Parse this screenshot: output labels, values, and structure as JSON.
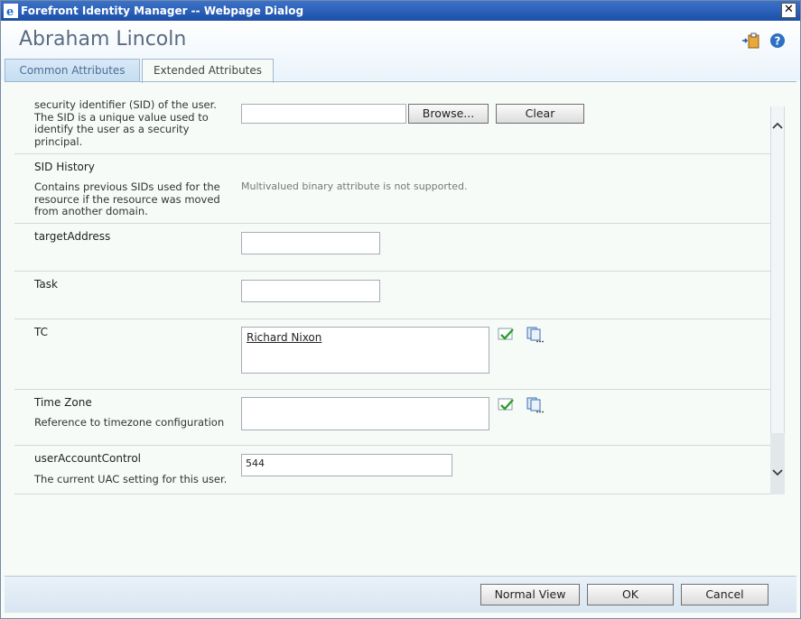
{
  "window": {
    "title": "Forefront Identity Manager -- Webpage Dialog",
    "close_label": "✕"
  },
  "header": {
    "title": "Abraham Lincoln",
    "icons": [
      "clipboard-icon",
      "help-icon"
    ]
  },
  "tabs": [
    {
      "label": "Common Attributes",
      "active": false
    },
    {
      "label": "Extended Attributes",
      "active": true
    }
  ],
  "rows": {
    "sid": {
      "desc_lines": [
        "security identifier (SID) of the user.",
        "The SID is a unique value used to",
        "identify the user as a security",
        "principal."
      ],
      "browse_label": "Browse...",
      "clear_label": "Clear"
    },
    "sid_history": {
      "label": "SID History",
      "desc_lines": [
        "Contains previous SIDs used for the",
        "resource if the resource was moved",
        "from another domain."
      ],
      "note": "Multivalued binary attribute is not supported."
    },
    "target_address": {
      "label": "targetAddress",
      "value": ""
    },
    "task": {
      "label": "Task",
      "value": ""
    },
    "tc": {
      "label": "TC",
      "value_link": "Richard Nixon"
    },
    "time_zone": {
      "label": "Time Zone",
      "desc": "Reference to timezone configuration",
      "value": ""
    },
    "uac": {
      "label": "userAccountControl",
      "desc": "The current UAC setting for this user.",
      "value": "544"
    }
  },
  "footer": {
    "normal_view_label": "Normal View",
    "ok_label": "OK",
    "cancel_label": "Cancel"
  },
  "colors": {
    "titlebar": "#1d4fa8",
    "content_bg": "#f6fbf7",
    "footer_bg": "#d8e5f1"
  }
}
